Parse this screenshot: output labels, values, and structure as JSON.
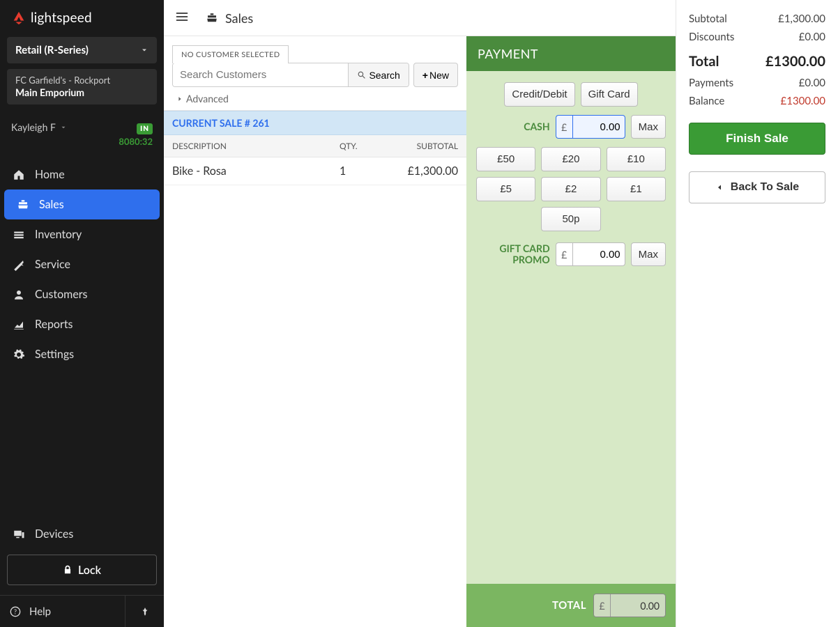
{
  "brand": "lightspeed",
  "product_selector": "Retail (R-Series)",
  "location": {
    "line1": "FC Garfield's - Rockport",
    "line2": "Main Emporium"
  },
  "user": {
    "name": "Kayleigh F",
    "status_badge": "IN",
    "clock": "8080:32"
  },
  "nav": {
    "home": "Home",
    "sales": "Sales",
    "inventory": "Inventory",
    "service": "Service",
    "customers": "Customers",
    "reports": "Reports",
    "settings": "Settings",
    "devices": "Devices"
  },
  "lock": "Lock",
  "help": "Help",
  "topbar": {
    "title": "Sales"
  },
  "customer": {
    "no_customer": "NO CUSTOMER SELECTED",
    "placeholder": "Search Customers",
    "search_btn": "Search",
    "new_btn": "New",
    "advanced": "Advanced"
  },
  "sale": {
    "header": "CURRENT SALE # 261",
    "columns": {
      "desc": "DESCRIPTION",
      "qty": "QTY.",
      "subtotal": "SUBTOTAL"
    },
    "lines": [
      {
        "desc": "Bike - Rosa",
        "qty": "1",
        "subtotal": "£1,300.00"
      }
    ]
  },
  "payment": {
    "header": "PAYMENT",
    "methods": {
      "credit_debit": "Credit/Debit",
      "gift_card": "Gift Card"
    },
    "cash_label": "CASH",
    "currency": "£",
    "cash_value": "0.00",
    "max": "Max",
    "denoms": [
      "£50",
      "£20",
      "£10",
      "£5",
      "£2",
      "£1",
      "50p"
    ],
    "gift_promo_label_1": "GIFT CARD",
    "gift_promo_label_2": "PROMO",
    "gift_promo_value": "0.00",
    "total_label": "TOTAL",
    "total_value": "0.00"
  },
  "summary": {
    "subtotal_label": "Subtotal",
    "subtotal": "£1,300.00",
    "discounts_label": "Discounts",
    "discounts": "£0.00",
    "total_label": "Total",
    "total": "£1300.00",
    "payments_label": "Payments",
    "payments": "£0.00",
    "balance_label": "Balance",
    "balance": "£1300.00",
    "finish": "Finish Sale",
    "back": "Back To Sale"
  }
}
